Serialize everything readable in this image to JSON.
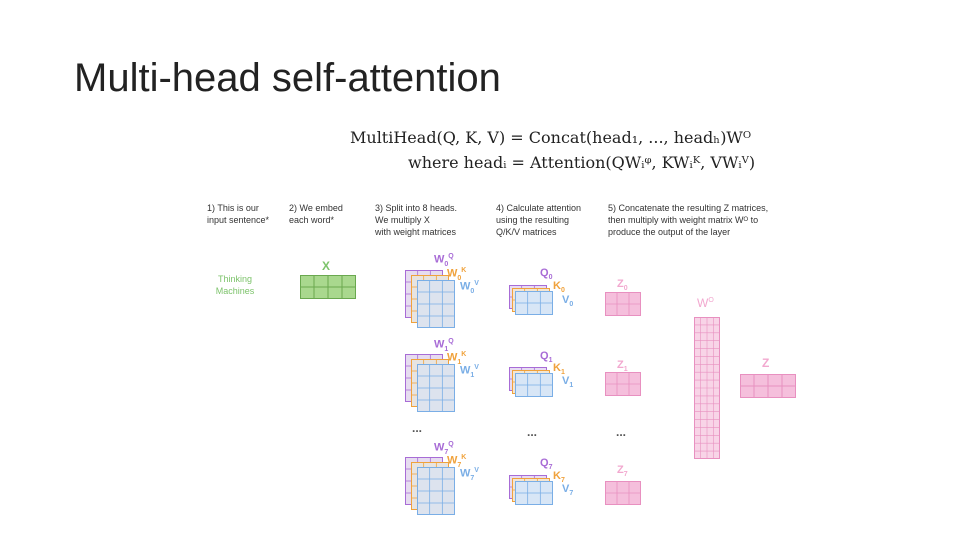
{
  "title": "Multi-head self-attention",
  "formula": {
    "line1": "MultiHead(Q, K, V) = Concat(head₁, ..., headₕ)Wᴼ",
    "line2": "where headᵢ = Attention(QWᵢᵠ, KWᵢᴷ, VWᵢⱽ)"
  },
  "steps": {
    "s1": [
      "1) This is our",
      "input sentence*"
    ],
    "s2": [
      "2) We embed",
      "each word*"
    ],
    "s3": [
      "3) Split into 8 heads.",
      "We multiply X",
      "with weight matrices"
    ],
    "s4": [
      "4) Calculate attention",
      "using the resulting",
      "Q/K/V matrices"
    ],
    "s5": [
      "5) Concatenate the resulting Z matrices,",
      "then multiply with weight matrix Wᴼ to",
      "produce the output of the layer"
    ]
  },
  "input_words": [
    "Thinking",
    "Machines"
  ],
  "labels": {
    "x": "X",
    "wo": "W",
    "wo_sup": "O",
    "z_out": "Z",
    "ellipsis": "...",
    "heads": [
      {
        "wq": "W",
        "wq_sub": "0",
        "wq_sup": "Q",
        "wk": "W",
        "wk_sub": "0",
        "wk_sup": "K",
        "wv": "W",
        "wv_sub": "0",
        "wv_sup": "V",
        "q": "Q",
        "q_sub": "0",
        "k": "K",
        "k_sub": "0",
        "v": "V",
        "v_sub": "0",
        "z": "Z",
        "z_sub": "0"
      },
      {
        "wq": "W",
        "wq_sub": "1",
        "wq_sup": "Q",
        "wk": "W",
        "wk_sub": "1",
        "wk_sup": "K",
        "wv": "W",
        "wv_sub": "1",
        "wv_sup": "V",
        "q": "Q",
        "q_sub": "1",
        "k": "K",
        "k_sub": "1",
        "v": "V",
        "v_sub": "1",
        "z": "Z",
        "z_sub": "1"
      },
      {
        "wq": "W",
        "wq_sub": "7",
        "wq_sup": "Q",
        "wk": "W",
        "wk_sub": "7",
        "wk_sup": "K",
        "wv": "W",
        "wv_sub": "7",
        "wv_sup": "V",
        "q": "Q",
        "q_sub": "7",
        "k": "K",
        "k_sub": "7",
        "v": "V",
        "v_sub": "7",
        "z": "Z",
        "z_sub": "7"
      }
    ]
  },
  "colors": {
    "x": "#7cc36a",
    "q": "#a86cd6",
    "k": "#f0a23c",
    "v": "#7aaee6",
    "z": "#f2a8cf",
    "wo": "#e890c0",
    "text": "#333333"
  }
}
